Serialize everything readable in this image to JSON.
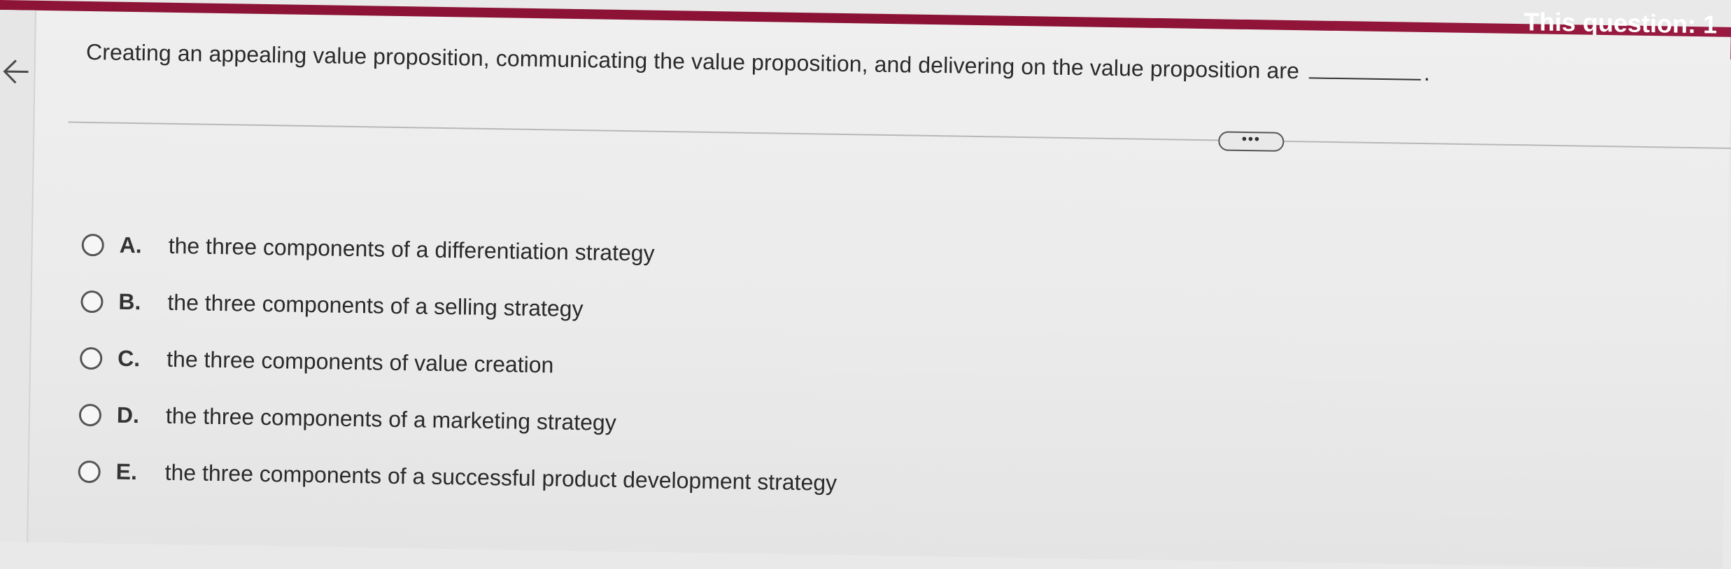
{
  "header": {
    "banner_text": "This question: 1"
  },
  "question": {
    "text": "Creating an appealing value proposition, communicating the value proposition, and delivering on the value proposition are",
    "end_punct": "."
  },
  "toolbar": {
    "more_label": "•••"
  },
  "options": [
    {
      "letter": "A.",
      "text": "the three components of a differentiation strategy"
    },
    {
      "letter": "B.",
      "text": "the three components of a selling strategy"
    },
    {
      "letter": "C.",
      "text": "the three components of value creation"
    },
    {
      "letter": "D.",
      "text": "the three components of a marketing strategy"
    },
    {
      "letter": "E.",
      "text": "the three components of a successful product development strategy"
    }
  ],
  "colors": {
    "banner": "#8d1436",
    "background": "#ebebeb",
    "text": "#2a2a2a"
  }
}
